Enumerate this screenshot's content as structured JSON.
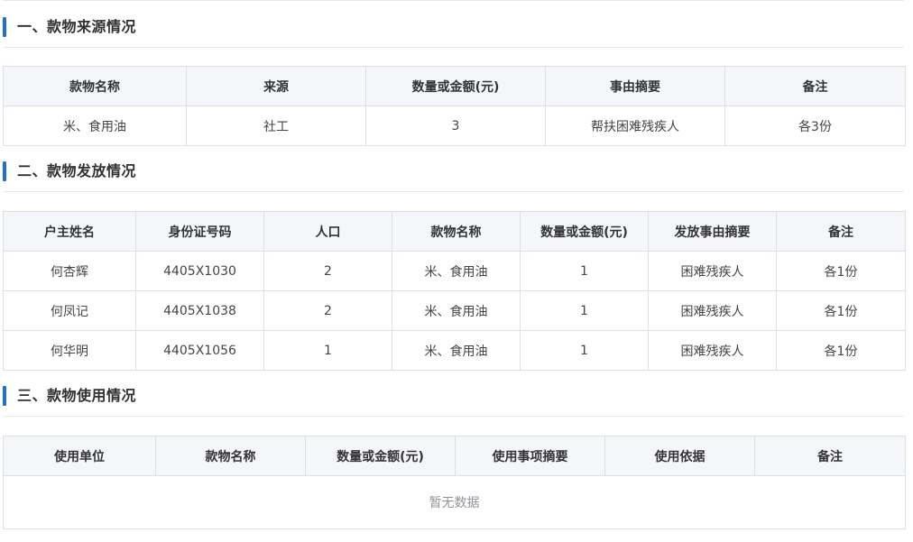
{
  "sections": [
    {
      "title": "一、款物来源情况",
      "columns": [
        "款物名称",
        "来源",
        "数量或金额(元)",
        "事由摘要",
        "备注"
      ],
      "rows": [
        [
          "米、食用油",
          "社工",
          "3",
          "帮扶困难残疾人",
          "各3份"
        ]
      ]
    },
    {
      "title": "二、款物发放情况",
      "columns": [
        "户主姓名",
        "身份证号码",
        "人口",
        "款物名称",
        "数量或金额(元)",
        "发放事由摘要",
        "备注"
      ],
      "rows": [
        [
          "何杏辉",
          "4405X1030",
          "2",
          "米、食用油",
          "1",
          "困难残疾人",
          "各1份"
        ],
        [
          "何凤记",
          "4405X1038",
          "2",
          "米、食用油",
          "1",
          "困难残疾人",
          "各1份"
        ],
        [
          "何华明",
          "4405X1056",
          "1",
          "米、食用油",
          "1",
          "困难残疾人",
          "各1份"
        ]
      ]
    },
    {
      "title": "三、款物使用情况",
      "columns": [
        "使用单位",
        "款物名称",
        "数量或金额(元)",
        "使用事项摘要",
        "使用依据",
        "备注"
      ],
      "empty_text": "暂无数据"
    }
  ],
  "colors": {
    "accent_bar": "#1e6fdc",
    "header_bg": "#f4f6f9",
    "border": "#dcdfe6",
    "empty_text": "#909399"
  }
}
